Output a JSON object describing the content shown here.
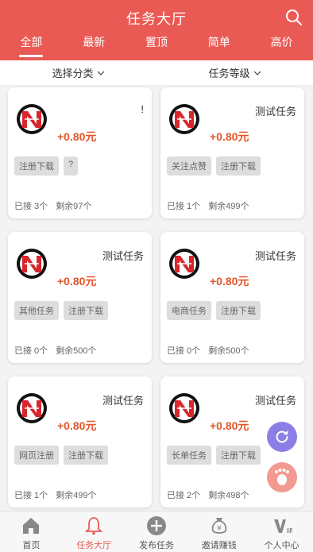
{
  "header": {
    "title": "任务大厅"
  },
  "tabs": [
    {
      "label": "全部"
    },
    {
      "label": "最新"
    },
    {
      "label": "置顶"
    },
    {
      "label": "简单"
    },
    {
      "label": "高价"
    }
  ],
  "filters": {
    "category": "选择分类",
    "level": "任务等级"
  },
  "cards": [
    {
      "title": "!",
      "price": "+0.80元",
      "tags": [
        "注册下载",
        "?"
      ],
      "accepted": "已接 3个",
      "remaining": "剩余97个"
    },
    {
      "title": "测试任务",
      "price": "+0.80元",
      "tags": [
        "关注点赞",
        "注册下载"
      ],
      "accepted": "已接 1个",
      "remaining": "剩余499个"
    },
    {
      "title": "测试任务",
      "price": "+0.80元",
      "tags": [
        "其他任务",
        "注册下载"
      ],
      "accepted": "已接 0个",
      "remaining": "剩余500个"
    },
    {
      "title": "测试任务",
      "price": "+0.80元",
      "tags": [
        "电商任务",
        "注册下载"
      ],
      "accepted": "已接 0个",
      "remaining": "剩余500个"
    },
    {
      "title": "测试任务",
      "price": "+0.80元",
      "tags": [
        "网页注册",
        "注册下载"
      ],
      "accepted": "已接 1个",
      "remaining": "剩余499个"
    },
    {
      "title": "测试任务",
      "price": "+0.80元",
      "tags": [
        "长单任务",
        "注册下载"
      ],
      "accepted": "已接 2个",
      "remaining": "剩余498个"
    }
  ],
  "bottom_nav": [
    {
      "label": "首页",
      "icon": "home-icon"
    },
    {
      "label": "任务大厅",
      "icon": "bell-icon"
    },
    {
      "label": "发布任务",
      "icon": "plus-circle-icon"
    },
    {
      "label": "邀请赚钱",
      "icon": "money-bag-icon"
    },
    {
      "label": "个人中心",
      "icon": "vip-icon"
    }
  ],
  "colors": {
    "primary": "#ea5a55",
    "price": "#e2562b",
    "refresh_button": "#8b7fe6",
    "foot_button": "#f29a92"
  }
}
